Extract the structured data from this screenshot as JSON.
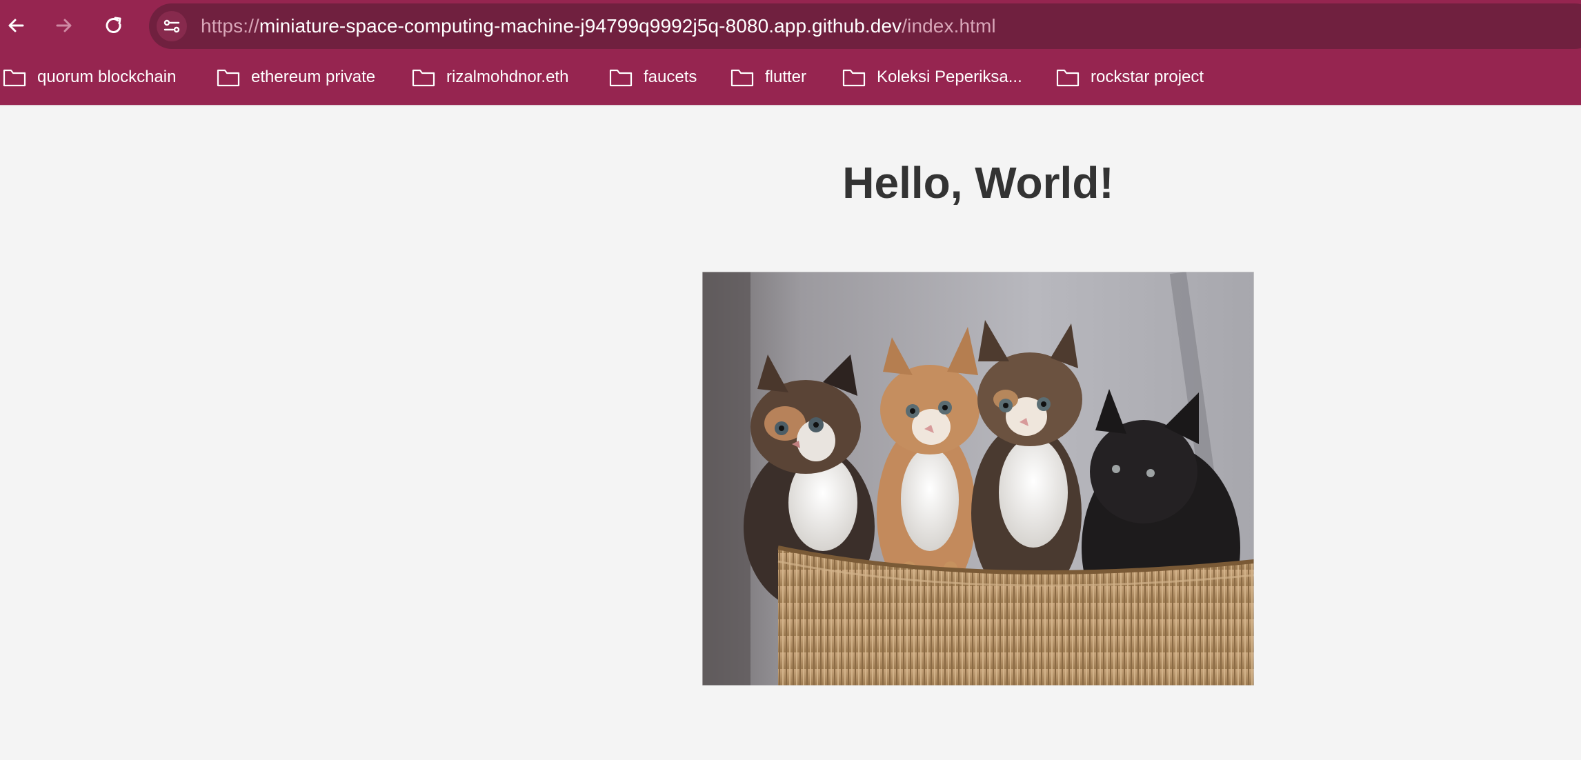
{
  "browser": {
    "url_prefix": "https://",
    "url_host": "miniature-space-computing-machine-j94799q9992j5q-8080.app.github.dev",
    "url_path": "/index.html",
    "back_icon": "arrow-left-icon",
    "forward_icon": "arrow-right-icon",
    "reload_icon": "reload-icon",
    "site_info_icon": "tune-icon",
    "theme_color": "#962550"
  },
  "bookmarks": [
    {
      "label": "quorum blockchain",
      "icon": "folder-icon"
    },
    {
      "label": "ethereum private",
      "icon": "folder-icon"
    },
    {
      "label": "rizalmohdnor.eth",
      "icon": "folder-icon"
    },
    {
      "label": "faucets",
      "icon": "folder-icon"
    },
    {
      "label": "flutter",
      "icon": "folder-icon"
    },
    {
      "label": "Koleksi Peperiksa...",
      "icon": "folder-icon"
    },
    {
      "label": "rockstar project",
      "icon": "folder-icon"
    }
  ],
  "page": {
    "heading": "Hello, World!",
    "image_subject": "four kittens in a woven basket"
  }
}
